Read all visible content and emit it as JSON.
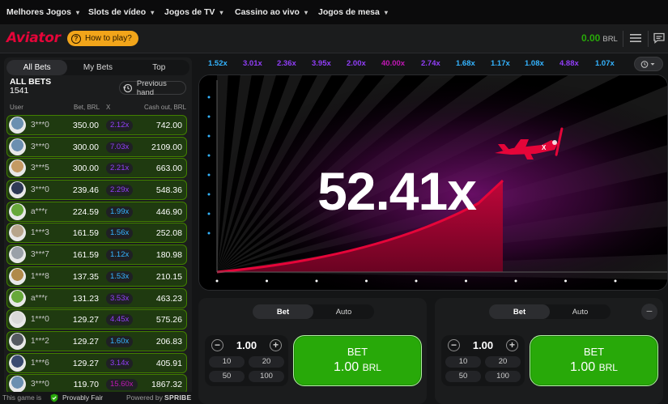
{
  "topnav": {
    "items": [
      "Melhores Jogos",
      "Slots de vídeo",
      "Jogos de TV",
      "Cassino ao vivo",
      "Jogos de mesa"
    ]
  },
  "header": {
    "logo": "Aviator",
    "how_to_play": "How to play?",
    "balance": "0.00",
    "currency": "BRL"
  },
  "bets_panel": {
    "tabs": [
      "All Bets",
      "My Bets",
      "Top"
    ],
    "active_tab": "All Bets",
    "title": "ALL BETS",
    "count": "1541",
    "previous_hand": "Previous hand",
    "columns": {
      "user": "User",
      "bet": "Bet, BRL",
      "x": "X",
      "cashout": "Cash out, BRL"
    },
    "rows": [
      {
        "user": "3***0",
        "bet": "350.00",
        "mult": "2.12x",
        "cash": "742.00",
        "mult_color": "#913ef8",
        "avatar": "#6b8fb0"
      },
      {
        "user": "3***0",
        "bet": "300.00",
        "mult": "7.03x",
        "cash": "2109.00",
        "mult_color": "#913ef8",
        "avatar": "#6b8fb0"
      },
      {
        "user": "3***5",
        "bet": "300.00",
        "mult": "2.21x",
        "cash": "663.00",
        "mult_color": "#913ef8",
        "avatar": "#c49a63"
      },
      {
        "user": "3***0",
        "bet": "239.46",
        "mult": "2.29x",
        "cash": "548.36",
        "mult_color": "#913ef8",
        "avatar": "#2e3a55"
      },
      {
        "user": "a***r",
        "bet": "224.59",
        "mult": "1.99x",
        "cash": "446.90",
        "mult_color": "#34b4ff",
        "avatar": "#67a83a"
      },
      {
        "user": "1***3",
        "bet": "161.59",
        "mult": "1.56x",
        "cash": "252.08",
        "mult_color": "#34b4ff",
        "avatar": "#b7a58b"
      },
      {
        "user": "3***7",
        "bet": "161.59",
        "mult": "1.12x",
        "cash": "180.98",
        "mult_color": "#34b4ff",
        "avatar": "#9aa0a8"
      },
      {
        "user": "1***8",
        "bet": "137.35",
        "mult": "1.53x",
        "cash": "210.15",
        "mult_color": "#34b4ff",
        "avatar": "#b08a4a"
      },
      {
        "user": "a***r",
        "bet": "131.23",
        "mult": "3.53x",
        "cash": "463.23",
        "mult_color": "#913ef8",
        "avatar": "#67a83a"
      },
      {
        "user": "1***0",
        "bet": "129.27",
        "mult": "4.45x",
        "cash": "575.26",
        "mult_color": "#913ef8",
        "avatar": "#d9d9d9"
      },
      {
        "user": "1***2",
        "bet": "129.27",
        "mult": "1.60x",
        "cash": "206.83",
        "mult_color": "#34b4ff",
        "avatar": "#555a60"
      },
      {
        "user": "1***6",
        "bet": "129.27",
        "mult": "3.14x",
        "cash": "405.91",
        "mult_color": "#913ef8",
        "avatar": "#3a4a70"
      },
      {
        "user": "3***0",
        "bet": "119.70",
        "mult": "15.60x",
        "cash": "1867.32",
        "mult_color": "#c017b4",
        "avatar": "#6b8fb0"
      }
    ],
    "footer_prefix": "This game is",
    "provably_fair": "Provably Fair",
    "powered_by": "Powered by",
    "powered_brand": "SPRIBE"
  },
  "history": [
    {
      "v": "1.52x",
      "c": "#34b4ff"
    },
    {
      "v": "3.01x",
      "c": "#913ef8"
    },
    {
      "v": "2.36x",
      "c": "#913ef8"
    },
    {
      "v": "3.95x",
      "c": "#913ef8"
    },
    {
      "v": "2.00x",
      "c": "#913ef8"
    },
    {
      "v": "40.00x",
      "c": "#c017b4"
    },
    {
      "v": "2.74x",
      "c": "#913ef8"
    },
    {
      "v": "1.68x",
      "c": "#34b4ff"
    },
    {
      "v": "1.17x",
      "c": "#34b4ff"
    },
    {
      "v": "1.08x",
      "c": "#34b4ff"
    },
    {
      "v": "4.88x",
      "c": "#913ef8"
    },
    {
      "v": "1.07x",
      "c": "#34b4ff"
    }
  ],
  "game": {
    "multiplier": "52.41x",
    "accent": "#e50539"
  },
  "bet_panels": [
    {
      "toggle": [
        "Bet",
        "Auto"
      ],
      "active": "Bet",
      "amount": "1.00",
      "quick": [
        "10",
        "20",
        "50",
        "100"
      ],
      "btn_label": "BET",
      "btn_amount": "1.00",
      "btn_currency": "BRL"
    },
    {
      "toggle": [
        "Bet",
        "Auto"
      ],
      "active": "Bet",
      "amount": "1.00",
      "quick": [
        "10",
        "20",
        "50",
        "100"
      ],
      "btn_label": "BET",
      "btn_amount": "1.00",
      "btn_currency": "BRL"
    }
  ]
}
